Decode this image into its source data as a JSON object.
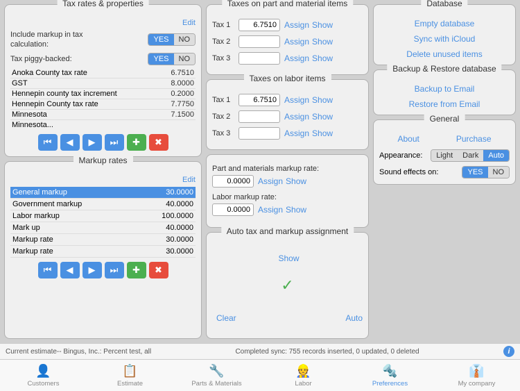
{
  "taxRatesPanel": {
    "title": "Tax rates & properties",
    "editLabel": "Edit",
    "includeTaxLabel": "Include markup in tax calculation:",
    "piggyBackLabel": "Tax piggy-backed:",
    "yesLabel": "YES",
    "noLabel": "NO",
    "rows": [
      {
        "name": "Anoka County tax rate",
        "value": "6.7510"
      },
      {
        "name": "GST",
        "value": "8.0000"
      },
      {
        "name": "Hennepin county tax increment",
        "value": "0.2000"
      },
      {
        "name": "Hennepin County tax rate",
        "value": "7.7750"
      },
      {
        "name": "Minnesota",
        "value": "7.1500"
      },
      {
        "name": "Minnesota...",
        "value": ""
      }
    ]
  },
  "markupRatesPanel": {
    "title": "Markup rates",
    "editLabel": "Edit",
    "rows": [
      {
        "name": "General markup",
        "value": "30.0000",
        "selected": true
      },
      {
        "name": "Government markup",
        "value": "40.0000",
        "selected": false
      },
      {
        "name": "Labor markup",
        "value": "100.0000",
        "selected": false
      },
      {
        "name": "Mark up",
        "value": "40.0000",
        "selected": false
      },
      {
        "name": "Markup rate",
        "value": "30.0000",
        "selected": false
      },
      {
        "name": "Markup rate",
        "value": "30.0000",
        "selected": false
      }
    ]
  },
  "taxesOnPartPanel": {
    "title": "Taxes on part and material items",
    "taxes": [
      {
        "label": "Tax 1",
        "value": "6.7510"
      },
      {
        "label": "Tax 2",
        "value": ""
      },
      {
        "label": "Tax 3",
        "value": ""
      }
    ],
    "assignLabel": "Assign",
    "showLabel": "Show"
  },
  "taxesOnLaborPanel": {
    "title": "Taxes on labor items",
    "taxes": [
      {
        "label": "Tax 1",
        "value": "6.7510"
      },
      {
        "label": "Tax 2",
        "value": ""
      },
      {
        "label": "Tax 3",
        "value": ""
      }
    ],
    "assignLabel": "Assign",
    "showLabel": "Show"
  },
  "markupRateSection": {
    "partLabel": "Part and materials markup rate:",
    "laborLabel": "Labor markup rate:",
    "partValue": "0.0000",
    "laborValue": "0.0000",
    "assignLabel": "Assign",
    "showLabel": "Show"
  },
  "autoTaxPanel": {
    "title": "Auto tax and markup assignment",
    "showLabel": "Show",
    "clearLabel": "Clear",
    "autoLabel": "Auto"
  },
  "databasePanel": {
    "title": "Database",
    "emptyDatabase": "Empty database",
    "syncWithICloud": "Sync with iCloud",
    "deleteUnusedItems": "Delete unused items"
  },
  "backupPanel": {
    "title": "Backup & Restore database",
    "backupToEmail": "Backup to Email",
    "restoreFromEmail": "Restore from Email"
  },
  "generalPanel": {
    "title": "General",
    "aboutLabel": "About",
    "purchaseLabel": "Purchase",
    "appearanceLabel": "Appearance:",
    "lightLabel": "Light",
    "darkLabel": "Dark",
    "autoLabel": "Auto",
    "soundEffectsLabel": "Sound effects on:",
    "yesLabel": "YES",
    "noLabel": "NO"
  },
  "statusBar": {
    "leftText": "Current estimate-- Bingus, Inc.: Percent test, all",
    "rightText": "Completed sync: 755 records inserted, 0 updated, 0 deleted"
  },
  "tabBar": {
    "tabs": [
      {
        "label": "Customers",
        "icon": "👤"
      },
      {
        "label": "Estimate",
        "icon": "📋"
      },
      {
        "label": "Parts & Materials",
        "icon": "🔧"
      },
      {
        "label": "Labor",
        "icon": "👷"
      },
      {
        "label": "Preferences",
        "icon": "🔩",
        "active": true
      },
      {
        "label": "My company",
        "icon": "👔"
      }
    ]
  }
}
